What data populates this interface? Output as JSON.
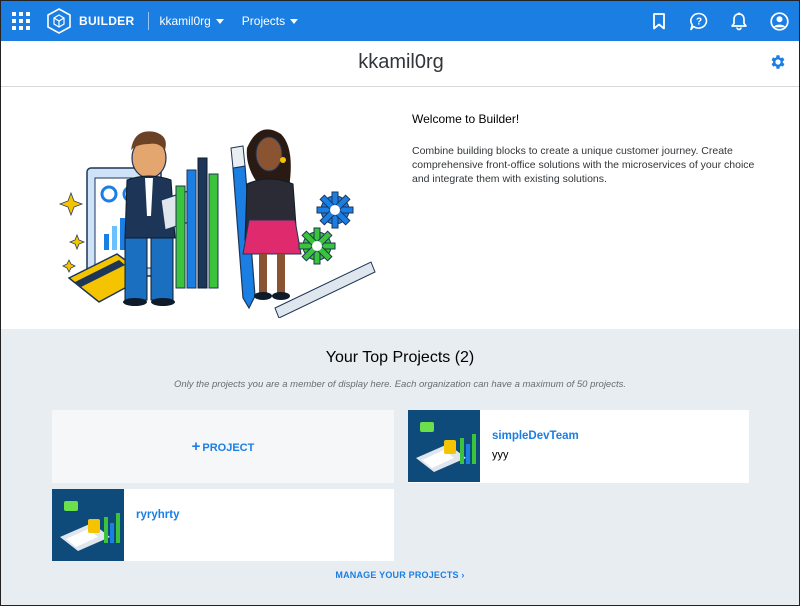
{
  "topbar": {
    "brand": "BUILDER",
    "org_menu": "kkamil0rg",
    "projects_menu": "Projects",
    "icons": [
      "grid-icon",
      "cube-logo-icon",
      "bookmark-icon",
      "help-icon",
      "bell-icon",
      "user-icon"
    ]
  },
  "header": {
    "title": "kkamil0rg",
    "settings_icon": "gear-icon"
  },
  "welcome": {
    "title": "Welcome to Builder!",
    "text": "Combine building blocks to create a unique customer journey. Create comprehensive front-office solutions with the microservices of your choice and integrate them with existing solutions."
  },
  "projects": {
    "title": "Your Top Projects (2)",
    "subtitle": "Only the projects you are a member of display here. Each organization can have a maximum of 50 projects.",
    "add_label": "PROJECT",
    "add_icon": "+",
    "items": [
      {
        "name": "simpleDevTeam",
        "description": "yyy"
      },
      {
        "name": "ryryhrty",
        "description": ""
      }
    ],
    "manage_link": "MANAGE YOUR PROJECTS ›"
  },
  "colors": {
    "accent": "#1a7ee3",
    "section_bg": "#e8edf2"
  }
}
